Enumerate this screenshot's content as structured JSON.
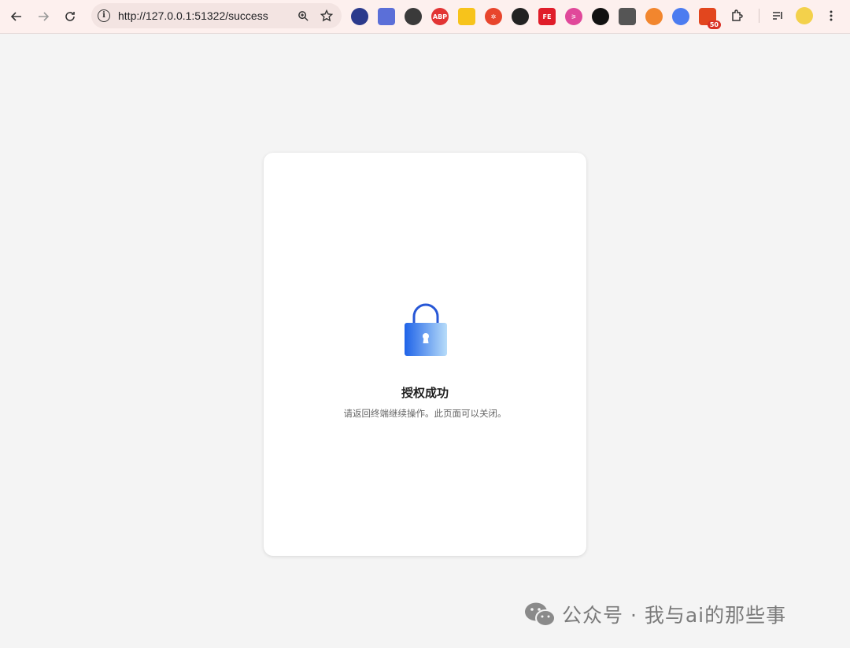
{
  "browser": {
    "url": "http://127.0.0.1:51322/success",
    "extensions": [
      {
        "name": "ext-1",
        "color": "#2b3a8c",
        "label": ""
      },
      {
        "name": "ext-2",
        "color": "#5b6fd8",
        "label": ""
      },
      {
        "name": "ext-3",
        "color": "#3a3a3a",
        "label": ""
      },
      {
        "name": "adblock-plus",
        "color": "#e23434",
        "label": "ABP"
      },
      {
        "name": "ext-5",
        "color": "#f7c31b",
        "label": ""
      },
      {
        "name": "ext-6",
        "color": "#e8452c",
        "label": "✲"
      },
      {
        "name": "ext-7",
        "color": "#222222",
        "label": ""
      },
      {
        "name": "fe-helper",
        "color": "#e01d2a",
        "label": "FE"
      },
      {
        "name": "ext-9",
        "color": "#e0489a",
        "label": "⚞"
      },
      {
        "name": "ext-10",
        "color": "#111111",
        "label": ""
      },
      {
        "name": "ext-11",
        "color": "#555555",
        "label": ""
      },
      {
        "name": "metamask",
        "color": "#f2862e",
        "label": ""
      },
      {
        "name": "ext-13",
        "color": "#4c7cf0",
        "label": ""
      },
      {
        "name": "ext-14",
        "color": "#e2461e",
        "label": "",
        "badge": "50"
      }
    ]
  },
  "auth": {
    "title": "授权成功",
    "message": "请返回终端继续操作。此页面可以关闭。"
  },
  "watermark": {
    "text": "公众号 · 我与ai的那些事"
  }
}
